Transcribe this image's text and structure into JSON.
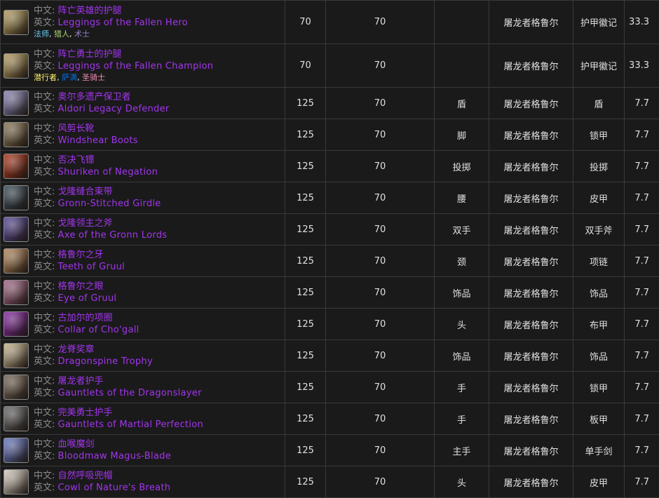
{
  "labels": {
    "cn": "中文:",
    "en": "英文:"
  },
  "rows": [
    {
      "cn": "阵亡英雄的护腿",
      "en": "Leggings of the Fallen Hero",
      "icon": "leggings-icon",
      "icon_color": "#b8a060",
      "classes": [
        {
          "name": "法师",
          "color": "#69ccf0"
        },
        {
          "name": "猎人",
          "color": "#abd473"
        },
        {
          "name": "术士",
          "color": "#9482c9"
        }
      ],
      "ilvl": "70",
      "req": "70",
      "slot": "",
      "boss": "屠龙者格鲁尔",
      "type": "护甲徽记",
      "tier": "33.3"
    },
    {
      "cn": "阵亡勇士的护腿",
      "en": "Leggings of the Fallen Champion",
      "icon": "leggings-icon",
      "icon_color": "#b8a060",
      "classes": [
        {
          "name": "潜行者",
          "color": "#fff569"
        },
        {
          "name": "萨满",
          "color": "#0070de"
        },
        {
          "name": "圣骑士",
          "color": "#f58cba"
        }
      ],
      "ilvl": "70",
      "req": "70",
      "slot": "",
      "boss": "屠龙者格鲁尔",
      "type": "护甲徽记",
      "tier": "33.3"
    },
    {
      "cn": "奥尔多遗产保卫者",
      "en": "Aldori Legacy Defender",
      "icon": "shield-icon",
      "icon_color": "#8a84b8",
      "ilvl": "125",
      "req": "70",
      "slot": "盾",
      "boss": "屠龙者格鲁尔",
      "type": "盾",
      "tier": "7.7"
    },
    {
      "cn": "风剪长靴",
      "en": "Windshear Boots",
      "icon": "boots-icon",
      "icon_color": "#8c7a58",
      "ilvl": "125",
      "req": "70",
      "slot": "脚",
      "boss": "屠龙者格鲁尔",
      "type": "锁甲",
      "tier": "7.7"
    },
    {
      "cn": "否决飞镖",
      "en": "Shuriken of Negation",
      "icon": "shuriken-icon",
      "icon_color": "#b23a1e",
      "ilvl": "125",
      "req": "70",
      "slot": "投掷",
      "boss": "屠龙者格鲁尔",
      "type": "投掷",
      "tier": "7.7"
    },
    {
      "cn": "戈隆缝合束带",
      "en": "Gronn-Stitched Girdle",
      "icon": "belt-icon",
      "icon_color": "#3c4f5c",
      "ilvl": "125",
      "req": "70",
      "slot": "腰",
      "boss": "屠龙者格鲁尔",
      "type": "皮甲",
      "tier": "7.7"
    },
    {
      "cn": "戈隆领主之斧",
      "en": "Axe of the Gronn Lords",
      "icon": "axe-icon",
      "icon_color": "#5a4a9a",
      "ilvl": "125",
      "req": "70",
      "slot": "双手",
      "boss": "屠龙者格鲁尔",
      "type": "双手斧",
      "tier": "7.7"
    },
    {
      "cn": "格鲁尔之牙",
      "en": "Teeth of Gruul",
      "icon": "teeth-icon",
      "icon_color": "#b88a5a",
      "ilvl": "125",
      "req": "70",
      "slot": "颈",
      "boss": "屠龙者格鲁尔",
      "type": "项链",
      "tier": "7.7"
    },
    {
      "cn": "格鲁尔之眼",
      "en": "Eye of Gruul",
      "icon": "eye-icon",
      "icon_color": "#a86a8a",
      "ilvl": "125",
      "req": "70",
      "slot": "饰品",
      "boss": "屠龙者格鲁尔",
      "type": "饰品",
      "tier": "7.7"
    },
    {
      "cn": "古加尔的项圈",
      "en": "Collar of Cho'gall",
      "icon": "collar-icon",
      "icon_color": "#8a2aa8",
      "ilvl": "125",
      "req": "70",
      "slot": "头",
      "boss": "屠龙者格鲁尔",
      "type": "布甲",
      "tier": "7.7"
    },
    {
      "cn": "龙脊奖章",
      "en": "Dragonspine Trophy",
      "icon": "trophy-icon",
      "icon_color": "#c8b890",
      "ilvl": "125",
      "req": "70",
      "slot": "饰品",
      "boss": "屠龙者格鲁尔",
      "type": "饰品",
      "tier": "7.7"
    },
    {
      "cn": "屠龙者护手",
      "en": "Gauntlets of the Dragonslayer",
      "icon": "gauntlet-icon",
      "icon_color": "#7a6a5a",
      "ilvl": "125",
      "req": "70",
      "slot": "手",
      "boss": "屠龙者格鲁尔",
      "type": "锁甲",
      "tier": "7.7"
    },
    {
      "cn": "完美勇士护手",
      "en": "Gauntlets of Martial Perfection",
      "icon": "gauntlet-icon",
      "icon_color": "#6a6a6a",
      "ilvl": "125",
      "req": "70",
      "slot": "手",
      "boss": "屠龙者格鲁尔",
      "type": "板甲",
      "tier": "7.7"
    },
    {
      "cn": "血喉魔剑",
      "en": "Bloodmaw Magus-Blade",
      "icon": "sword-icon",
      "icon_color": "#6a7ac8",
      "ilvl": "125",
      "req": "70",
      "slot": "主手",
      "boss": "屠龙者格鲁尔",
      "type": "单手剑",
      "tier": "7.7"
    },
    {
      "cn": "自然呼吸兜帽",
      "en": "Cowl of Nature's Breath",
      "icon": "cowl-icon",
      "icon_color": "#d8d0c0",
      "ilvl": "125",
      "req": "70",
      "slot": "头",
      "boss": "屠龙者格鲁尔",
      "type": "皮甲",
      "tier": "7.7"
    }
  ]
}
